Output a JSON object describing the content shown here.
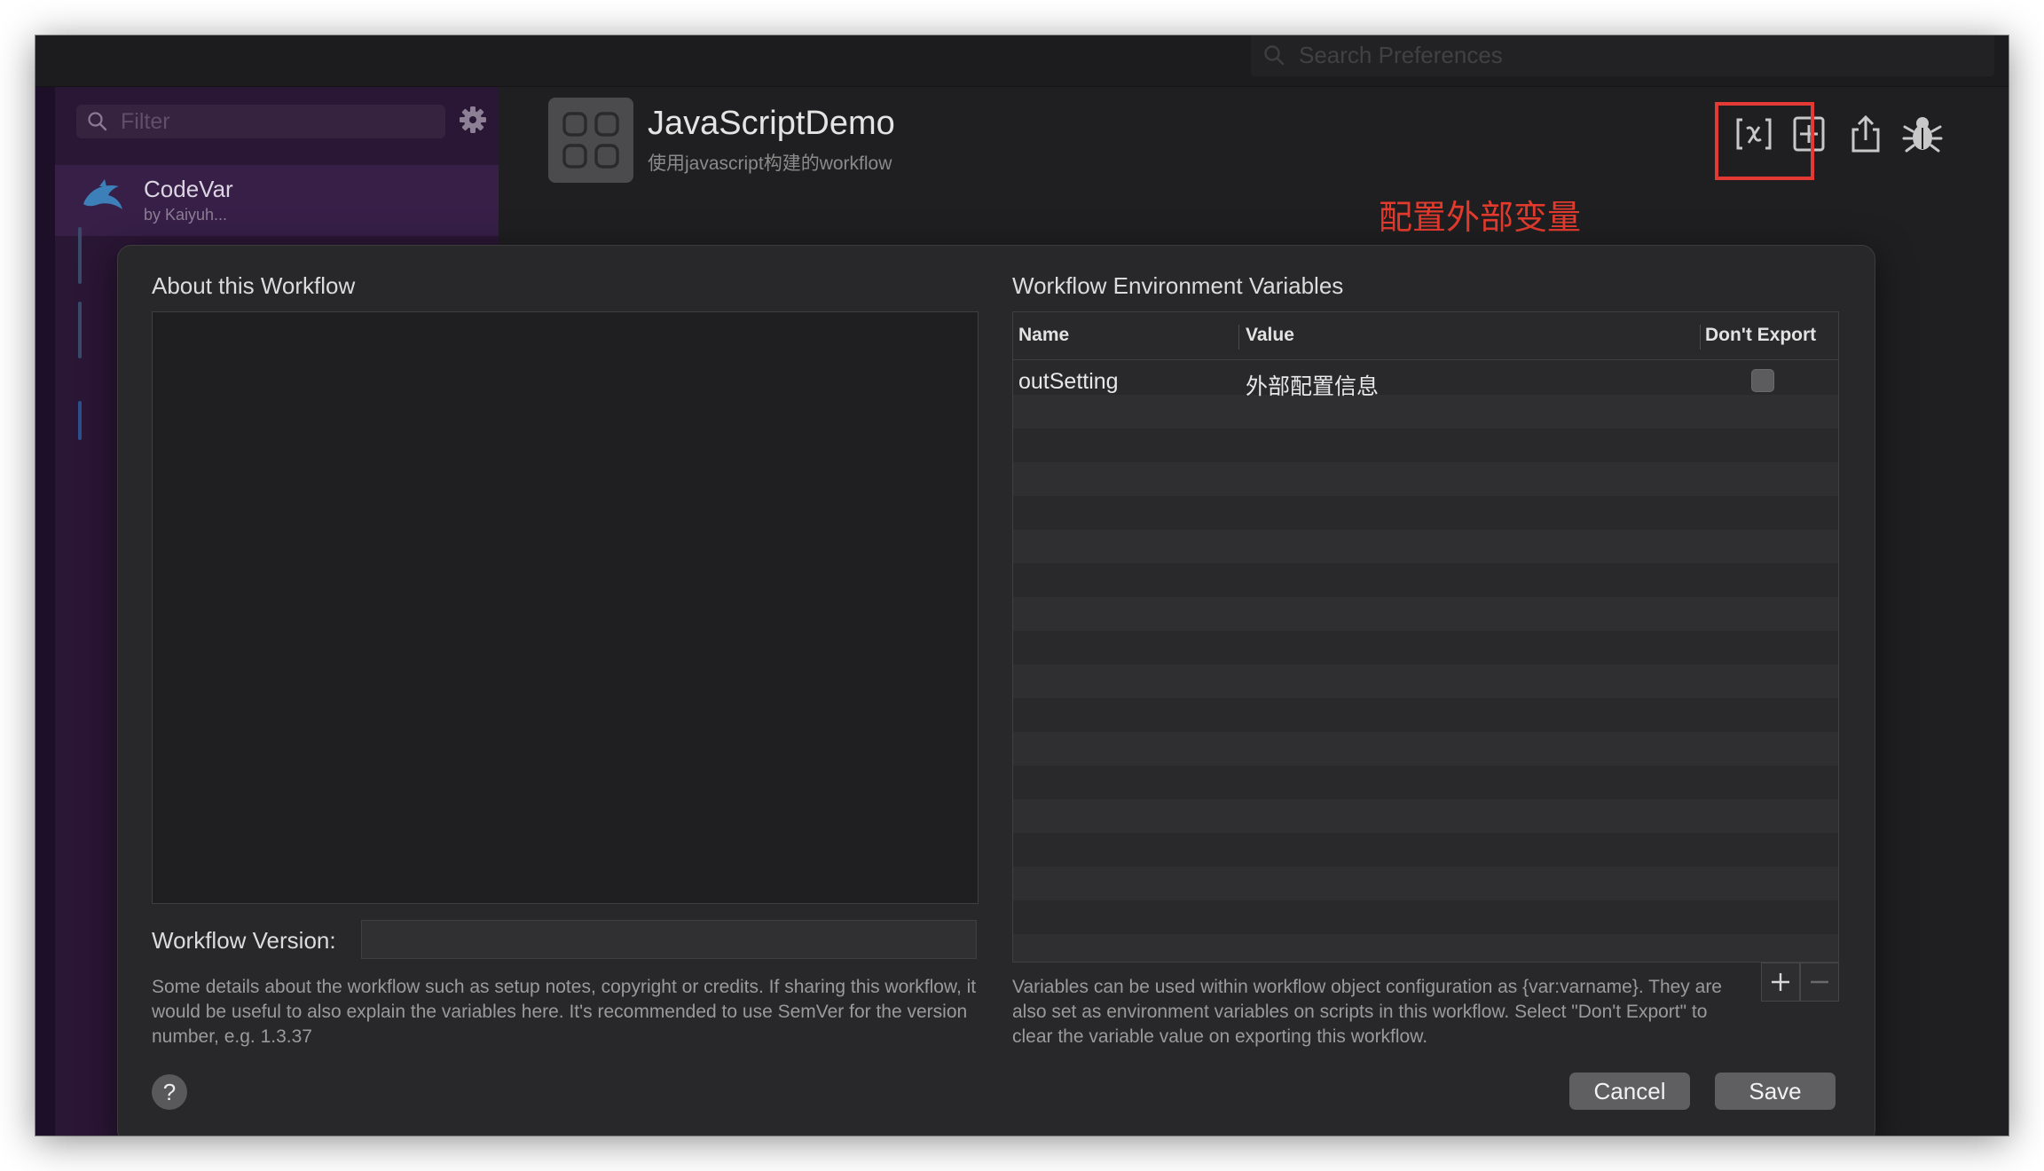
{
  "window": {
    "search_placeholder": "Search Preferences"
  },
  "sidebar": {
    "filter_placeholder": "Filter",
    "selected_workflow": {
      "name": "CodeVar",
      "subtitle": "by Kaiyuh..."
    }
  },
  "header": {
    "title": "JavaScriptDemo",
    "subtitle": "使用javascript构建的workflow",
    "annotation": "配置外部变量"
  },
  "toolbar": {
    "icons": [
      "variables-icon",
      "add-object-icon",
      "share-icon",
      "debug-bug-icon"
    ]
  },
  "sheet": {
    "about_title": "About this Workflow",
    "version_label": "Workflow Version:",
    "version_value": "",
    "about_help": "Some details about the workflow such as setup notes, copyright or credits. If sharing this workflow, it would be useful to also explain the variables here. It's recommended to use SemVer for the version number, e.g. 1.3.37",
    "env_title": "Workflow Environment Variables",
    "columns": {
      "name": "Name",
      "value": "Value",
      "dont_export": "Don't Export"
    },
    "variables": [
      {
        "name": "outSetting",
        "value": "外部配置信息",
        "dont_export": false
      }
    ],
    "env_help": "Variables can be used within workflow object configuration as {var:varname}. They are also set as environment variables on scripts in this workflow. Select \"Don't Export\" to clear the variable value on exporting this workflow.",
    "help_glyph": "?",
    "cancel_label": "Cancel",
    "save_label": "Save"
  },
  "colors": {
    "accent_red": "#e53935",
    "sidebar_purple": "#2a1635"
  }
}
